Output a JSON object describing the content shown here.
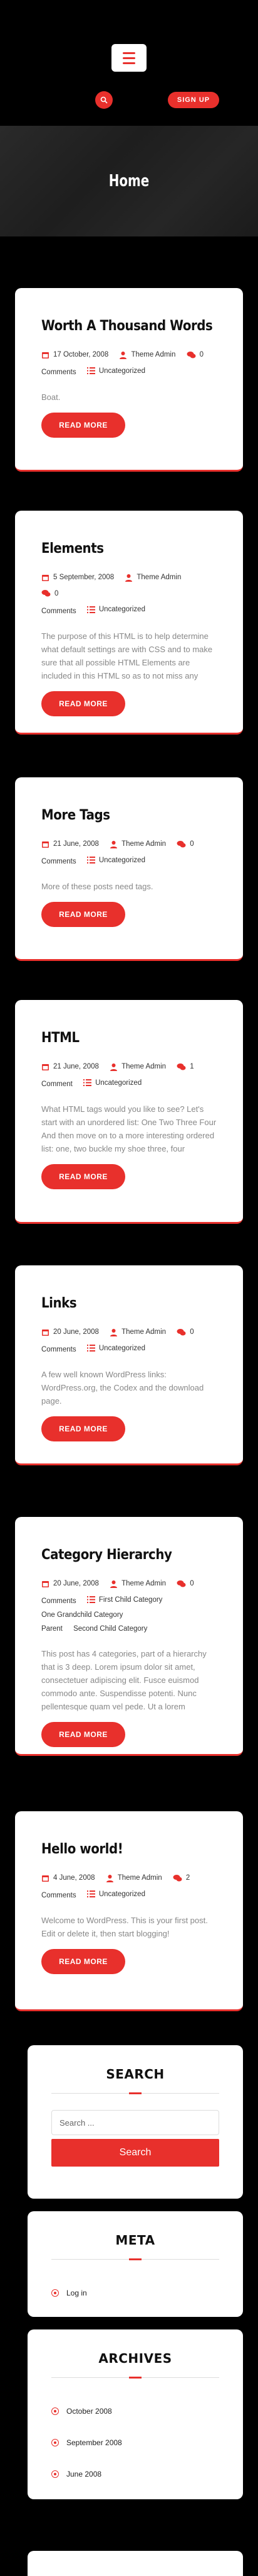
{
  "header": {
    "menu_icon": "hamburger-icon",
    "search_icon": "search-icon",
    "signup_label": "SIGN UP"
  },
  "hero": {
    "title": "Home"
  },
  "posts": [
    {
      "title": "Worth A Thousand Words",
      "date": "17 October, 2008",
      "author": "Theme Admin",
      "comments_count": "0",
      "comments_label": "Comments",
      "categories": [
        "Uncategorized"
      ],
      "excerpt": "Boat.",
      "read_more": "READ MORE"
    },
    {
      "title": "Elements",
      "date": "5 September, 2008",
      "author": "Theme Admin",
      "comments_count": "0",
      "comments_label": "Comments",
      "categories": [
        "Uncategorized"
      ],
      "excerpt": "The purpose of this HTML is to help determine what default settings are with CSS and to make sure that all possible HTML Elements are included in this HTML so as to not miss any",
      "read_more": "READ MORE"
    },
    {
      "title": "More Tags",
      "date": "21 June, 2008",
      "author": "Theme Admin",
      "comments_count": "0",
      "comments_label": "Comments",
      "categories": [
        "Uncategorized"
      ],
      "excerpt": "More of these posts need tags.",
      "read_more": "READ MORE"
    },
    {
      "title": "HTML",
      "date": "21 June, 2008",
      "author": "Theme Admin",
      "comments_count": "1",
      "comments_label": "Comment",
      "categories": [
        "Uncategorized"
      ],
      "excerpt": "What HTML tags would you like to see? Let's start with an unordered list: One Two Three Four And then move on to a more interesting ordered list: one, two buckle my shoe three, four",
      "read_more": "READ MORE"
    },
    {
      "title": "Links",
      "date": "20 June, 2008",
      "author": "Theme Admin",
      "comments_count": "0",
      "comments_label": "Comments",
      "categories": [
        "Uncategorized"
      ],
      "excerpt": "A few well known WordPress links: WordPress.org, the Codex and the download page.",
      "read_more": "READ MORE"
    },
    {
      "title": "Category Hierarchy",
      "date": "20 June, 2008",
      "author": "Theme Admin",
      "comments_count": "0",
      "comments_label": "Comments",
      "categories": [
        "First Child Category",
        "One Grandchild Category",
        "Parent",
        "Second Child Category"
      ],
      "excerpt": "This post has 4 categories, part of a hierarchy that is 3 deep. Lorem ipsum dolor sit amet, consectetuer adipiscing elit. Fusce euismod commodo ante. Suspendisse potenti. Nunc pellentesque quam vel pede. Ut a lorem",
      "read_more": "READ MORE"
    },
    {
      "title": "Hello world!",
      "date": "4 June, 2008",
      "author": "Theme Admin",
      "comments_count": "2",
      "comments_label": "Comments",
      "categories": [
        "Uncategorized"
      ],
      "excerpt": "Welcome to WordPress. This is your first post. Edit or delete it, then start blogging!",
      "read_more": "READ MORE"
    }
  ],
  "widgets": {
    "search": {
      "title": "SEARCH",
      "placeholder": "Search ...",
      "button": "Search"
    },
    "meta": {
      "title": "META",
      "items": [
        "Log in"
      ]
    },
    "archives": {
      "title": "ARCHIVES",
      "items": [
        "October 2008",
        "September 2008",
        "June 2008"
      ]
    }
  },
  "colors": {
    "accent": "#e8302c",
    "background": "#000000",
    "card": "#ffffff"
  }
}
